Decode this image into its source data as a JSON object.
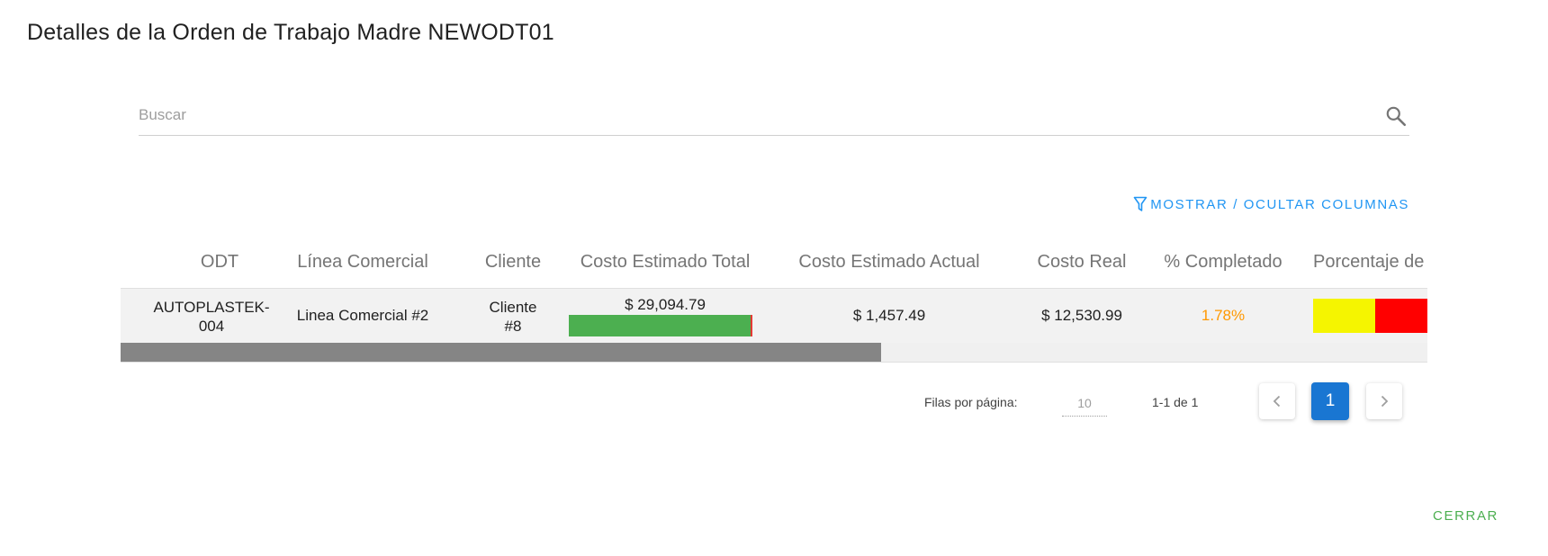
{
  "dialog": {
    "title": "Detalles de la Orden de Trabajo Madre NEWODT01",
    "close_label": "CERRAR"
  },
  "search": {
    "placeholder": "Buscar",
    "value": "",
    "icon": "search-icon"
  },
  "toolbar": {
    "columns_toggle_label": "MOSTRAR / OCULTAR COLUMNAS",
    "columns_toggle_icon": "filter-icon"
  },
  "table": {
    "headers": [
      "ODT",
      "Línea Comercial",
      "Cliente",
      "Costo Estimado Total",
      "Costo Estimado Actual",
      "Costo Real",
      "% Completado",
      "Porcentaje de"
    ],
    "rows": [
      {
        "odt_line1": "AUTOPLASTEK-",
        "odt_line2": "004",
        "linea_comercial": "Linea Comercial #2",
        "cliente_line1": "Cliente",
        "cliente_line2": "#8",
        "costo_estimado_total": "$ 29,094.79",
        "costo_estimado_actual": "$ 1,457.49",
        "costo_real": "$ 12,530.99",
        "completado": "1.78%",
        "porcentaje_yellow_fraction": 0.39,
        "porcentaje_red_fraction": 0.61
      }
    ],
    "scroll_position": 0
  },
  "pagination": {
    "rows_per_page_label": "Filas por página:",
    "rows_per_page_value": "10",
    "range_label": "1-1 de 1",
    "current_page": "1",
    "prev_icon": "chevron-left-icon",
    "next_icon": "chevron-right-icon"
  },
  "colors": {
    "accent_blue": "#1976d2",
    "link_blue": "#2196f3",
    "green": "#4caf50",
    "orange": "#ff9800",
    "yellow": "#f5f500",
    "red": "#ff0000"
  }
}
